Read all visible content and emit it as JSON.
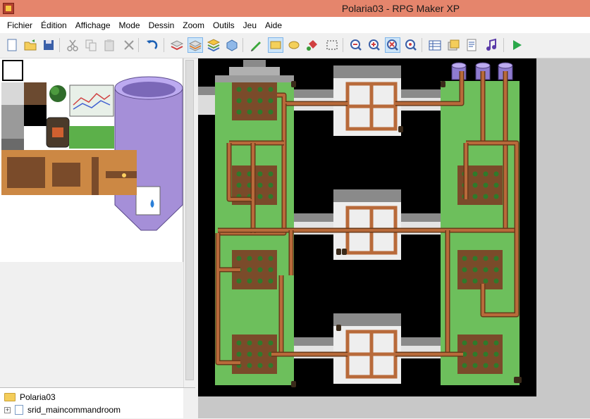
{
  "window": {
    "title": "Polaria03 - RPG Maker XP"
  },
  "menu": [
    "Fichier",
    "Édition",
    "Affichage",
    "Mode",
    "Dessin",
    "Zoom",
    "Outils",
    "Jeu",
    "Aide"
  ],
  "toolbar": {
    "buttons": [
      {
        "name": "new-icon",
        "active": false
      },
      {
        "name": "open-icon",
        "active": false
      },
      {
        "name": "save-icon",
        "active": false
      },
      {
        "name": "cut-icon",
        "active": false
      },
      {
        "name": "copy-icon",
        "active": false
      },
      {
        "name": "paste-icon",
        "active": false
      },
      {
        "name": "delete-icon",
        "active": false
      },
      {
        "name": "undo-icon",
        "active": false
      },
      {
        "name": "layer1-icon",
        "active": false
      },
      {
        "name": "layer2-icon",
        "active": true
      },
      {
        "name": "layer3-icon",
        "active": false
      },
      {
        "name": "events-layer-icon",
        "active": false
      },
      {
        "name": "pencil-icon",
        "active": false
      },
      {
        "name": "rectangle-icon",
        "active": true
      },
      {
        "name": "ellipse-icon",
        "active": false
      },
      {
        "name": "fill-icon",
        "active": false
      },
      {
        "name": "select-icon",
        "active": false
      },
      {
        "name": "zoom-1-icon",
        "active": false
      },
      {
        "name": "zoom-2-icon",
        "active": false
      },
      {
        "name": "zoom-4-icon",
        "active": true
      },
      {
        "name": "zoom-8-icon",
        "active": false
      },
      {
        "name": "database-icon",
        "active": false
      },
      {
        "name": "materials-icon",
        "active": false
      },
      {
        "name": "script-editor-icon",
        "active": false
      },
      {
        "name": "sound-test-icon",
        "active": false
      },
      {
        "name": "playtest-icon",
        "active": false
      }
    ]
  },
  "tree": {
    "project": "Polaria03",
    "maps": [
      "srid_maincommandroom"
    ]
  },
  "colors": {
    "titlebar": "#e5856c",
    "grass": "#6dbf5c",
    "dirt": "#7a4b2a",
    "pipe": "#b86a3a",
    "wall": "#8a8a8a",
    "void": "#000000"
  }
}
